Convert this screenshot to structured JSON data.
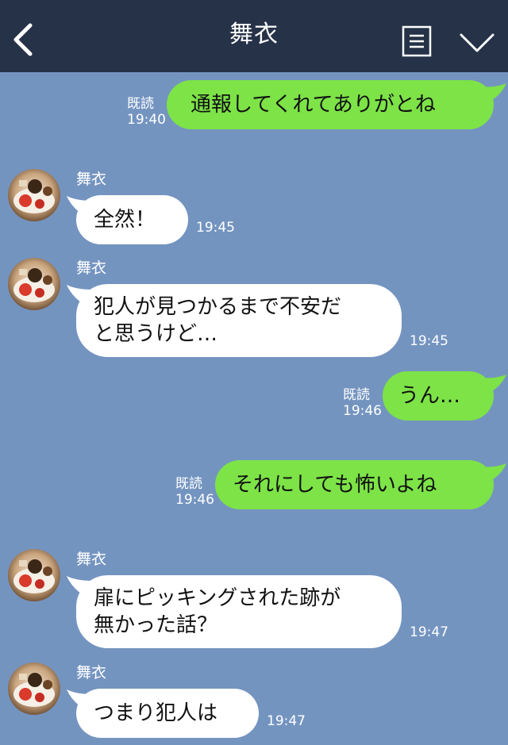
{
  "header": {
    "title": "舞衣",
    "back_icon": "chevron-left-icon",
    "menu_icon": "menu-icon",
    "collapse_icon": "chevron-down-icon"
  },
  "colors": {
    "header_bg": "#263248",
    "chat_bg": "#7494c0",
    "outgoing_bubble": "#7de347",
    "incoming_bubble": "#ffffff"
  },
  "messages": [
    {
      "direction": "out",
      "text": "通報してくれてありがとね",
      "read_label": "既読",
      "time": "19:40"
    },
    {
      "direction": "in",
      "sender": "舞衣",
      "text": "全然！",
      "time": "19:45"
    },
    {
      "direction": "in",
      "sender": "舞衣",
      "lines": [
        "犯人が見つかるまで不安だ",
        "と思うけど…"
      ],
      "time": "19:45"
    },
    {
      "direction": "out",
      "text": "うん…",
      "read_label": "既読",
      "time": "19:46"
    },
    {
      "direction": "out",
      "text": "それにしても怖いよね",
      "read_label": "既読",
      "time": "19:46"
    },
    {
      "direction": "in",
      "sender": "舞衣",
      "lines": [
        "扉にピッキングされた跡が",
        "無かった話？"
      ],
      "time": "19:47"
    },
    {
      "direction": "in",
      "sender": "舞衣",
      "text": "つまり犯人は",
      "time": "19:47"
    }
  ]
}
